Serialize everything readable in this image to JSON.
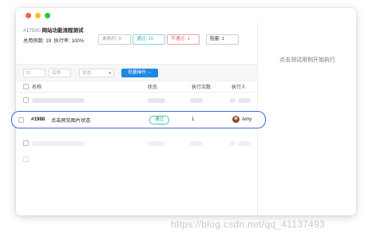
{
  "plan": {
    "id": "#17500",
    "title": "网站功能流程测试"
  },
  "stats": {
    "total_label": "总用例数: 19",
    "rate_label": "执行率: 100%",
    "pending": "未执行: 0",
    "passed": "通过: 10",
    "failed": "不通过: 1",
    "blocked": "阻塞: 1"
  },
  "toolbar": {
    "id_placeholder": "ID",
    "name_placeholder": "名称",
    "status_placeholder": "状态",
    "batch_label": "批量操作"
  },
  "table": {
    "headers": {
      "name": "名称",
      "status": "状态",
      "executions": "执行次数",
      "assignee": "执行人"
    },
    "highlighted_row": {
      "id": "#1988",
      "name": "点击预览图片状态",
      "status": "通过",
      "executions": "1",
      "assignee": "Amy"
    }
  },
  "right_panel": {
    "hint": "点击测试用例开始执行"
  },
  "watermark": "https://blog.csdn.net/qq_41137493",
  "colors": {
    "accent": "#1e88e5",
    "highlight_border": "#3a6cdb",
    "passed": "#3cb1c8",
    "failed": "#e0596f",
    "badge_pass": "#2fa996"
  }
}
